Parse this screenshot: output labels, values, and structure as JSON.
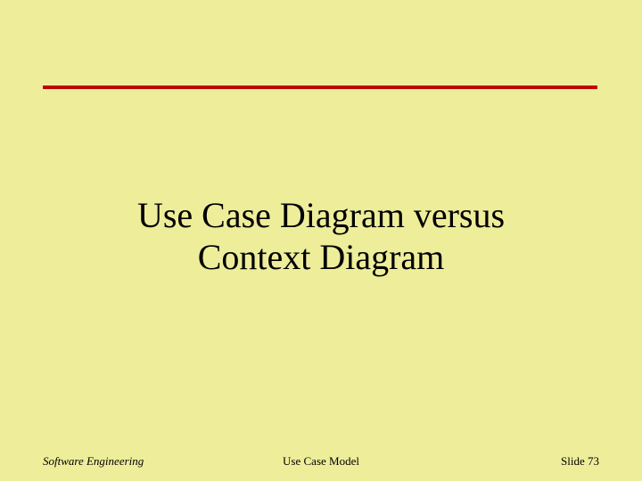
{
  "title": {
    "line1": "Use Case Diagram versus",
    "line2": "Context Diagram"
  },
  "footer": {
    "left": "Software Engineering",
    "center": "Use Case Model",
    "right_label": "Slide",
    "right_number": "73"
  }
}
